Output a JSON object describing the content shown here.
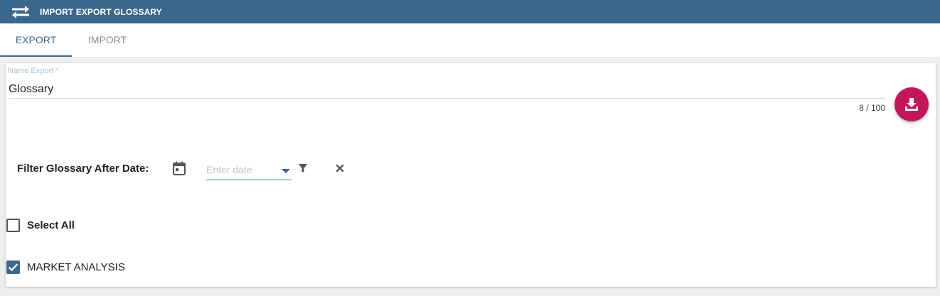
{
  "header": {
    "title": "IMPORT EXPORT GLOSSARY",
    "icon": "swap-arrows-icon",
    "background_color": "#3b678d"
  },
  "tabs": [
    {
      "label": "EXPORT",
      "active": true
    },
    {
      "label": "IMPORT",
      "active": false
    }
  ],
  "export_form": {
    "name_field": {
      "label": "Name Export *",
      "value": "Glossary",
      "counter": "8 / 100"
    },
    "download_button": {
      "icon": "download-icon",
      "color": "#c2185b"
    },
    "date_filter": {
      "label": "Filter Glossary After Date:",
      "placeholder": "Enter date",
      "calendar_icon": "calendar-icon",
      "dropdown_icon": "chevron-down-icon",
      "filter_icon": "filter-icon",
      "clear_icon": "close-icon"
    },
    "select_all": {
      "label": "Select All",
      "checked": false
    },
    "items": [
      {
        "label": "MARKET ANALYSIS",
        "checked": true
      }
    ]
  },
  "colors": {
    "accent": "#3b678d",
    "fab": "#c2185b"
  }
}
